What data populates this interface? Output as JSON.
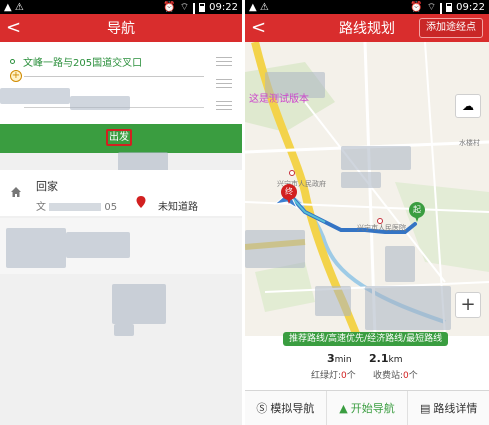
{
  "left": {
    "status_time": "09:22",
    "title": "导航",
    "from": "文峰一路与205国道交叉口",
    "dest_placeholder": "",
    "go_label": "出发",
    "home_label": "回家",
    "home_sub": "文",
    "home_sub_tail": "05",
    "unknown_road": "未知道路",
    "colors": {
      "red": "#d92d2d",
      "green": "#3a9d40"
    },
    "icons": [
      "back-icon",
      "add-icon",
      "drag-handle-icon",
      "home-icon",
      "marker-icon"
    ]
  },
  "right": {
    "status_time": "09:22",
    "title": "路线规划",
    "add_waypoint": "添加途经点",
    "watermark": "这是测试版本",
    "map_labels": {
      "gov": "兴宁市人民政府",
      "hospital": "兴宁市人民医院",
      "shuilou": "水楼村"
    },
    "end_marker": "终",
    "start_marker": "起",
    "strategy": "推荐路线/高速优先/经济路线/最短路线",
    "time_value": "3",
    "time_unit": "min",
    "distance_value": "2.1",
    "distance_unit": "km",
    "lights_label": "红绿灯:",
    "lights_count": "0",
    "lights_unit": "个",
    "toll_label": "收费站:",
    "toll_count": "0",
    "toll_unit": "个",
    "buttons": {
      "simulate": "模拟导航",
      "start": "开始导航",
      "details": "路线详情"
    },
    "zoom_in": "+",
    "icons": [
      "back-icon",
      "weather-icon",
      "zoom-in-icon",
      "simulate-icon",
      "navigate-arrow-icon",
      "details-icon"
    ]
  }
}
